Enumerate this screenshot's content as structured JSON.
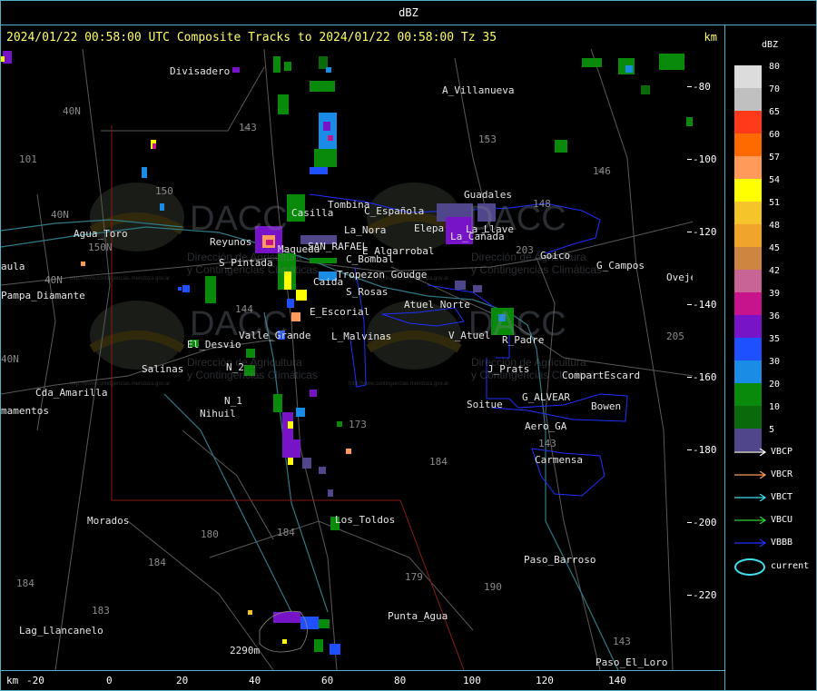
{
  "window": {
    "title": "dBZ"
  },
  "header": {
    "title": "2024/01/22 00:58:00 UTC Composite Tracks to 2024/01/22 00:58:00 Tz 35",
    "unit": "km"
  },
  "axes": {
    "x_unit": "km",
    "x_ticks": [
      "-20",
      "0",
      "20",
      "40",
      "60",
      "80",
      "100",
      "120",
      "140"
    ],
    "y_ticks": [
      "-80",
      "-100",
      "-120",
      "-140",
      "-160",
      "-180",
      "-200",
      "-220"
    ]
  },
  "legend": {
    "title": "dBZ",
    "scale": [
      {
        "label": "80",
        "color": "#dcdcdc"
      },
      {
        "label": "70",
        "color": "#c0c0c0"
      },
      {
        "label": "65",
        "color": "#ff3a1a"
      },
      {
        "label": "60",
        "color": "#ff6a00"
      },
      {
        "label": "57",
        "color": "#ff9a5a"
      },
      {
        "label": "54",
        "color": "#ffff00"
      },
      {
        "label": "51",
        "color": "#f5c42a"
      },
      {
        "label": "48",
        "color": "#f0a52a"
      },
      {
        "label": "45",
        "color": "#cd853f"
      },
      {
        "label": "42",
        "color": "#c86496"
      },
      {
        "label": "39",
        "color": "#c8148c"
      },
      {
        "label": "36",
        "color": "#7814c8"
      },
      {
        "label": "35",
        "color": "#1e50ff"
      },
      {
        "label": "30",
        "color": "#1a8ce6"
      },
      {
        "label": "20",
        "color": "#0a8a0a"
      },
      {
        "label": "10",
        "color": "#0a6a0a"
      },
      {
        "label": "5",
        "color": "#50468c"
      }
    ],
    "tracks": [
      {
        "label": "VBCP",
        "color": "#ffffff"
      },
      {
        "label": "VBCR",
        "color": "#ff9a5a"
      },
      {
        "label": "VBCT",
        "color": "#40e0f0"
      },
      {
        "label": "VBCU",
        "color": "#30d030"
      },
      {
        "label": "VBBB",
        "color": "#2030ff"
      }
    ],
    "current_label": "current",
    "current_color": "#40e0f0"
  },
  "map": {
    "places": [
      {
        "name": "Divisadero"
      },
      {
        "name": "A_Villanueva"
      },
      {
        "name": "Guadales"
      },
      {
        "name": "La_Nora"
      },
      {
        "name": "C_Española"
      },
      {
        "name": "Elepa"
      },
      {
        "name": "Reyunos"
      },
      {
        "name": "SAN_RAFAEL"
      },
      {
        "name": "E_Algarrobal"
      },
      {
        "name": "C_Bombal"
      },
      {
        "name": "S_Pintada"
      },
      {
        "name": "Tropezon Goudge"
      },
      {
        "name": "Goico"
      },
      {
        "name": "G_Campos"
      },
      {
        "name": "Ovejeria"
      },
      {
        "name": "Agua_Toro"
      },
      {
        "name": "Pampa_Diamante"
      },
      {
        "name": "Caida"
      },
      {
        "name": "S_Rosas"
      },
      {
        "name": "Atuel Norte"
      },
      {
        "name": "E_Escorial"
      },
      {
        "name": "L_Malvinas"
      },
      {
        "name": "V_Atuel"
      },
      {
        "name": "R_Padre"
      },
      {
        "name": "Valle_Grande"
      },
      {
        "name": "El_Desvio"
      },
      {
        "name": "Salinas"
      },
      {
        "name": "N_2"
      },
      {
        "name": "J_Prats"
      },
      {
        "name": "CompartEscard"
      },
      {
        "name": "G_ALVEAR"
      },
      {
        "name": "Bowen"
      },
      {
        "name": "Cda_Amarilla"
      },
      {
        "name": "N_1"
      },
      {
        "name": "Nihuil"
      },
      {
        "name": "Soitue"
      },
      {
        "name": "Aero_GA"
      },
      {
        "name": "Carmensa"
      },
      {
        "name": "Morados"
      },
      {
        "name": "Los_Toldos"
      },
      {
        "name": "Paso_Barroso"
      },
      {
        "name": "Punta_Agua"
      },
      {
        "name": "Lag_Llancanelo"
      },
      {
        "name": "Paso_El_Loro"
      },
      {
        "name": "mamentos"
      },
      {
        "name": "aula"
      },
      {
        "name": "Tombina"
      },
      {
        "name": "Casilla"
      },
      {
        "name": "Maqueda"
      },
      {
        "name": "La_Cañada"
      },
      {
        "name": "La_Llave"
      },
      {
        "name": "2290m"
      }
    ],
    "route_numbers": [
      "101",
      "40N",
      "40N",
      "40N",
      "40N",
      "143",
      "153",
      "146",
      "148",
      "150",
      "150N",
      "144",
      "203",
      "205",
      "173",
      "184",
      "180",
      "184",
      "184",
      "183",
      "184",
      "179",
      "190",
      "143",
      "143",
      "40N"
    ],
    "watermark": {
      "brand": "DACC",
      "line1": "Dirección de Agricultura",
      "line2": "y Contingencias Climáticas",
      "url": "http://www.contingencias.mendoza.gov.ar"
    }
  }
}
